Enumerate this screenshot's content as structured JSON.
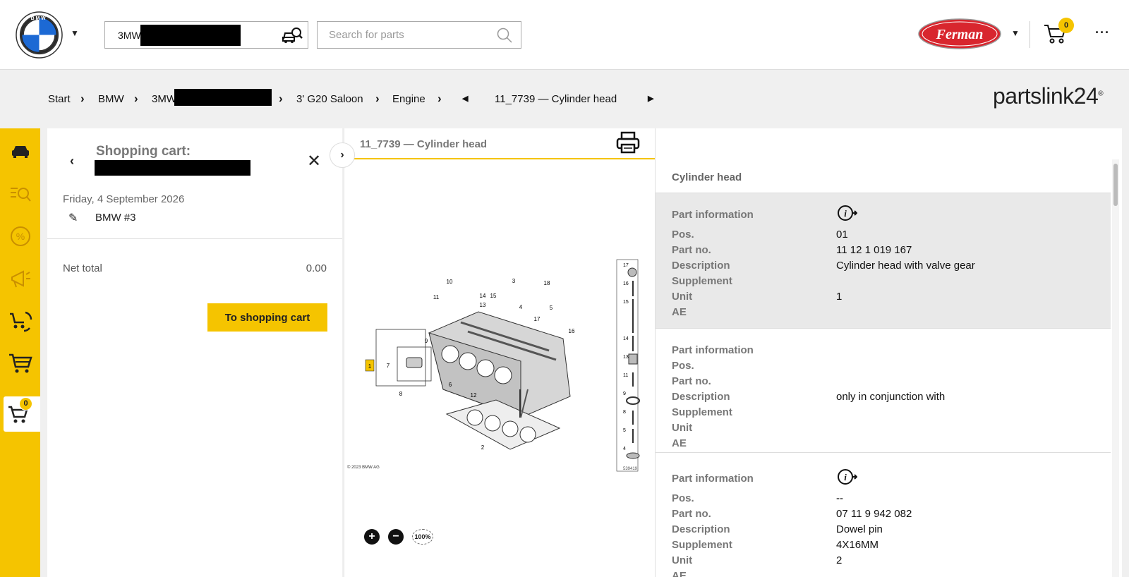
{
  "header": {
    "brand_logo": "bmw-logo",
    "vin_prefix": "3MW",
    "search_placeholder": "Search for parts",
    "dealer_logo_text": "Ferman",
    "cart_count": "0",
    "more_label": "···"
  },
  "breadcrumb": {
    "items": [
      "Start",
      "BMW",
      "3MW",
      "3' G20 Saloon",
      "Engine",
      "11_7739 — Cylinder head"
    ],
    "brand": "partslink24",
    "brand_mark": "®"
  },
  "rail": {
    "cart_badge": "0",
    "icons": [
      "car-icon",
      "search-list-icon",
      "percent-icon",
      "megaphone-icon",
      "exchange-cart-icon",
      "shopping-cart-icon",
      "shopping-cart-active-icon"
    ]
  },
  "cart_panel": {
    "title": "Shopping cart:",
    "date": "Friday, 4 September 2026",
    "cart_name": "BMW #3",
    "net_total_label": "Net total",
    "net_total_value": "0.00",
    "button_label": "To shopping cart"
  },
  "diagram": {
    "title": "11_7739 — Cylinder head",
    "copyright": "© 2023 BMW AG",
    "image_id": "539419",
    "zoom_100_label": "100%",
    "callouts": [
      "1",
      "2",
      "3",
      "4",
      "5",
      "6",
      "7",
      "8",
      "9",
      "10",
      "11",
      "12",
      "13",
      "14",
      "15",
      "16",
      "17",
      "18"
    ]
  },
  "info": {
    "section_title": "Cylinder head",
    "labels": {
      "header": "Part information",
      "pos": "Pos.",
      "part_no": "Part no.",
      "description": "Description",
      "supplement": "Supplement",
      "unit": "Unit",
      "ae": "AE"
    },
    "parts": [
      {
        "pos": "01",
        "part_no": "11 12 1 019 167",
        "description": "Cylinder head with valve gear",
        "supplement": "",
        "unit": "1",
        "ae": ""
      },
      {
        "pos": "",
        "part_no": "",
        "description": "only in conjunction with",
        "supplement": "",
        "unit": "",
        "ae": ""
      },
      {
        "pos": "--",
        "part_no": "07 11 9 942 082",
        "description": "Dowel pin",
        "supplement": "4X16MM",
        "unit": "2",
        "ae": ""
      }
    ]
  }
}
